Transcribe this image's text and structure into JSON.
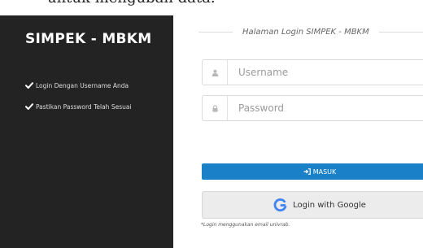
{
  "top_text": "untuk mengubah data.",
  "sidebar": {
    "title": "SIMPEK - MBKM",
    "items": [
      {
        "icon": "check-icon",
        "label": "Login Dengan Username Anda"
      },
      {
        "icon": "check-icon",
        "label": "Pastikan Password Telah Sesuai"
      }
    ]
  },
  "login": {
    "heading": "Halaman Login SIMPEK - MBKM",
    "username": {
      "icon": "user-icon",
      "placeholder": "Username",
      "value": ""
    },
    "password": {
      "icon": "lock-icon",
      "placeholder": "Password",
      "value": ""
    },
    "submit": {
      "icon": "sign-in-icon",
      "label": "MASUK"
    },
    "google": {
      "icon": "google-icon",
      "label": "Login with Google"
    },
    "note": "*Login menggunakan email univrab."
  },
  "colors": {
    "sidebar_bg": "#232323",
    "primary_button": "#1a81c8",
    "google_button_bg": "#ececec",
    "google_blue": "#4285F4"
  }
}
